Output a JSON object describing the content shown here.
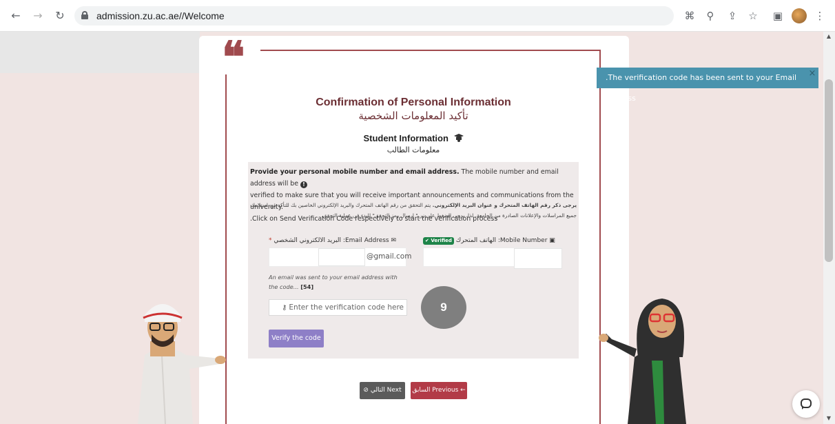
{
  "browser": {
    "url": "admission.zu.ac.ae//Welcome"
  },
  "toast": {
    "message": ".The verification code has been sent to your Email Address",
    "close": "×"
  },
  "header": {
    "title_en": "Confirmation of Personal Information",
    "title_ar": "تأكيد المعلومات الشخصية",
    "subtitle_en": "Student Information",
    "subtitle_ar": "معلومات الطالب"
  },
  "info": {
    "bold_en": "Provide your personal mobile number and email address.",
    "text_en_1": " The mobile number and email address will be ",
    "text_en_2": "verified to make sure that you will receive important announcements and communications from the university.",
    "text_en_3": ".Click on Send Verification Code respectively to start the verification process",
    "bold_ar": "يرجى ذكر رقم الهاتف المتحرك و عنوان البريد الإلكتروني.",
    "text_ar": " يتم التحقق من رقم الهاتف المتحرك والبريد الإلكتروني الخاصين بك للتأكد من استلامك جميع المراسلات والإعلانات الصادرة من الجامعة. لذا، يرجى الضغط على زر \" إرسال رمز التحقق\" للبدء في عملية التحقق."
  },
  "email": {
    "label_en": "Email Address",
    "label_ar": "البريد الالكتروني الشخصي",
    "required": "*",
    "suffix": "@gmail.com",
    "note": "An email was sent to your email address with the code...",
    "countdown": "[54]",
    "code_placeholder": "Enter the verification code here",
    "verify_label": "Verify the code"
  },
  "mobile": {
    "label_en": "Mobile Number",
    "label_ar": "الهاتف المتحرك",
    "verified": "Verified"
  },
  "badge": "9",
  "nav": {
    "next_en": "Next",
    "next_ar": "التالي",
    "prev_en": "Previous",
    "prev_ar": "السابق"
  },
  "colors": {
    "brand": "#a04a4e",
    "toast": "#4a93ad",
    "verify_button": "#8e7fc7",
    "previous_button": "#b23b47",
    "next_button": "#5b5b5b",
    "verified_badge": "#1e8449"
  }
}
